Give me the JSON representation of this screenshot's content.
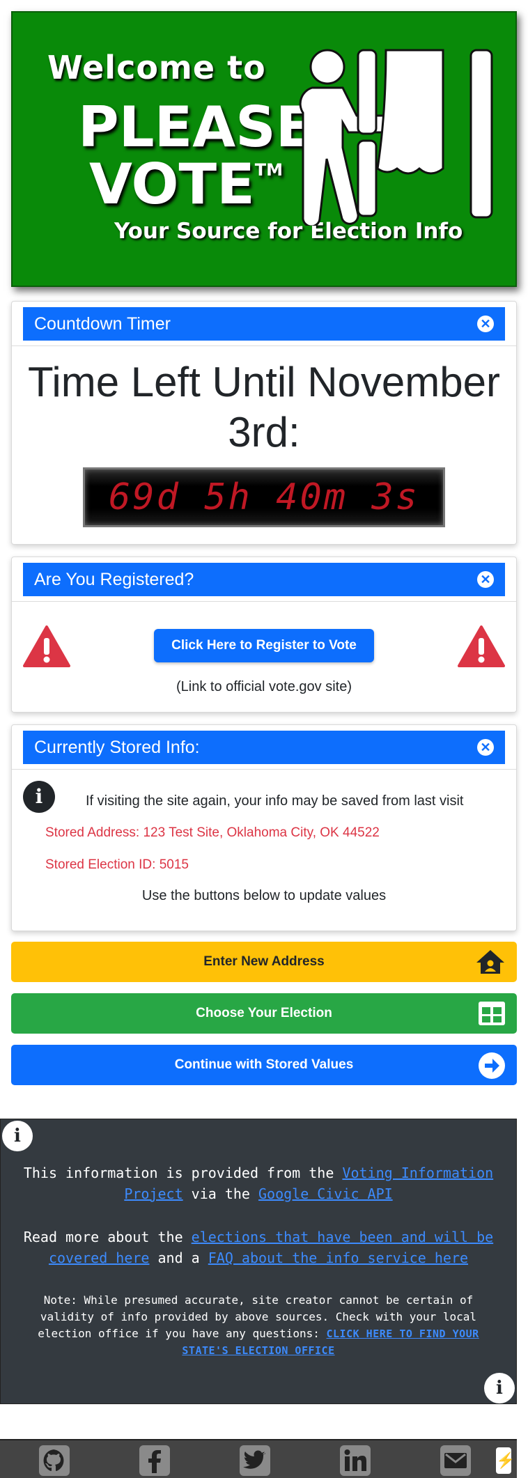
{
  "banner": {
    "welcome": "Welcome to",
    "title_line1": "PLEASE",
    "title_line2": "VOTE",
    "trademark": "TM",
    "tagline": "Your Source for Election Info"
  },
  "countdown": {
    "header": "Countdown Timer",
    "heading": "Time Left Until November 3rd:",
    "timer": "69d 5h 40m 3s"
  },
  "registration": {
    "header": "Are You Registered?",
    "button": "Click Here to Register to Vote",
    "note": "(Link to official vote.gov site)"
  },
  "stored_info": {
    "header": "Currently Stored Info:",
    "notice": "If visiting the site again, your info may be saved from last visit",
    "address_label": "Stored Address: 123 Test Site, Oklahoma City, OK 44522",
    "election_label": "Stored Election ID: 5015",
    "instructions": "Use the buttons below to update values"
  },
  "actions": {
    "new_address": "Enter New Address",
    "choose_election": "Choose Your Election",
    "continue": "Continue with Stored Values"
  },
  "footer_info": {
    "p1_prefix": "This information is provided from the ",
    "p1_link1": "Voting Information Project",
    "p1_mid": " via the ",
    "p1_link2": "Google Civic API",
    "p2_prefix": "Read more about the ",
    "p2_link1": "elections that have been and will be covered here",
    "p2_mid": " and a ",
    "p2_link2": "FAQ about the info service here",
    "note": "Note: While presumed accurate, site creator cannot be certain of validity of info provided by above sources. Check with your local election office if you have any questions: ",
    "note_link": "CLICK HERE TO FIND YOUR STATE'S ELECTION OFFICE"
  },
  "social": [
    "github-icon",
    "facebook-icon",
    "twitter-icon",
    "linkedin-icon",
    "email-icon",
    "bolt-icon"
  ],
  "colors": {
    "banner_green": "#098a09",
    "primary_blue": "#0d6efd",
    "warning_yellow": "#ffc107",
    "success_green": "#28a745",
    "danger_red": "#dc3545",
    "dark_panel": "#343a40"
  }
}
